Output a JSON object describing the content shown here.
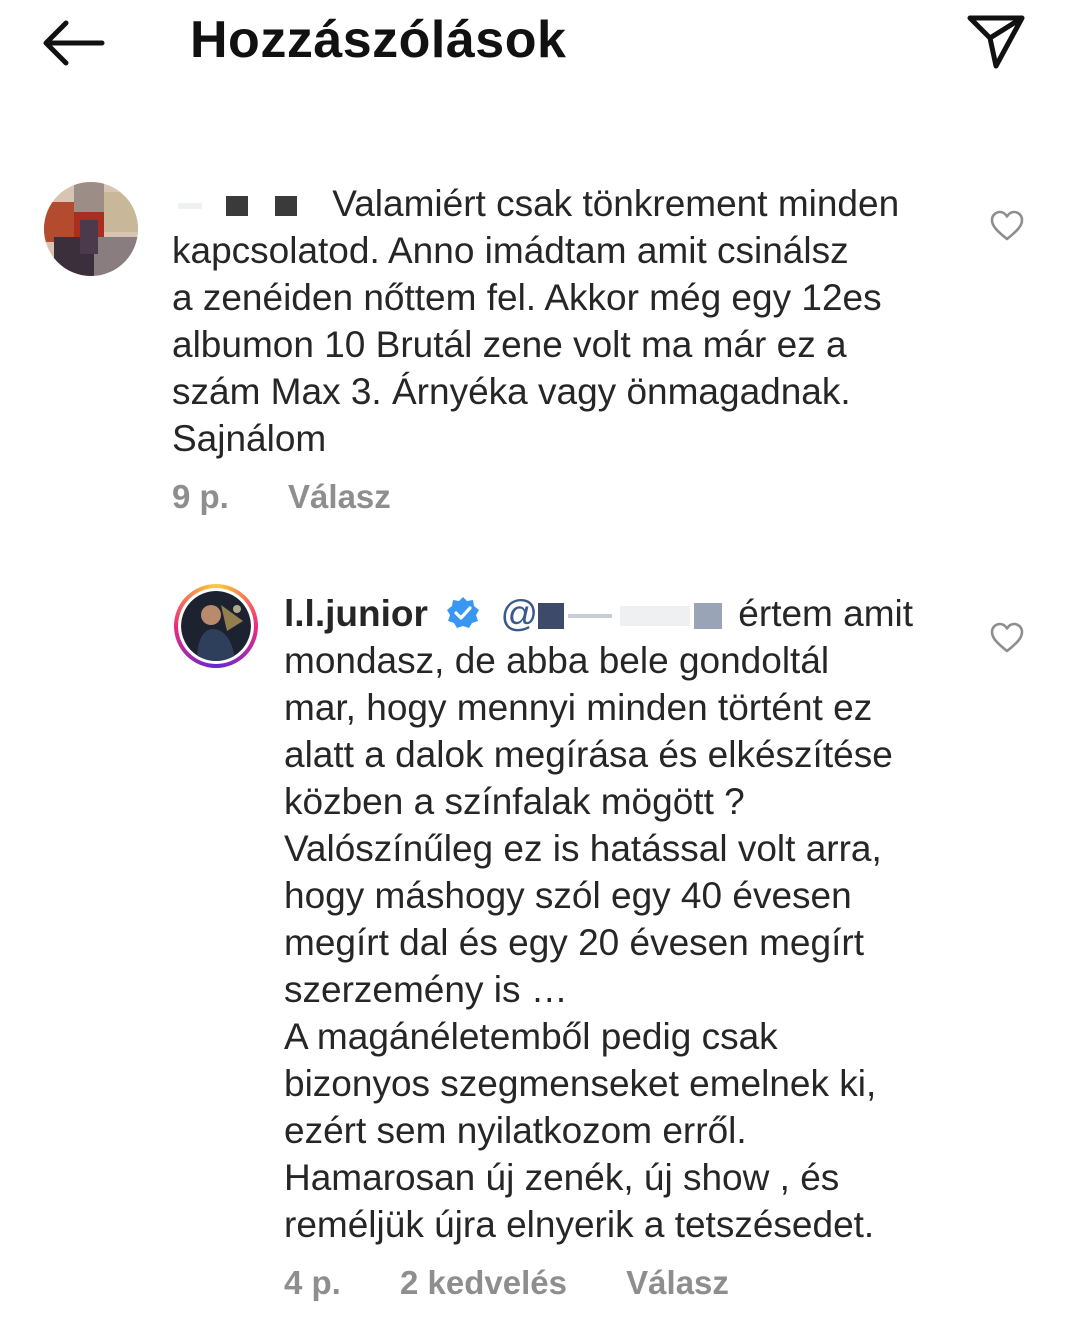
{
  "header": {
    "title": "Hozzászólások",
    "back_icon": "arrow-left-icon",
    "share_icon": "send-paper-plane-icon"
  },
  "comments": [
    {
      "username": "",
      "text_lines": [
        "Valamiért csak tönkrement minden",
        "kapcsolatod.  Anno imádtam amit csinálsz",
        "a zenéiden nőttem fel.  Akkor még egy 12es",
        "albumon 10 Brutál zene volt ma már ez a",
        "szám Max 3.  Árnyéka vagy önmagadnak.",
        "Sajnálom"
      ],
      "time": "9 p.",
      "reply_label": "Válasz"
    },
    {
      "username": "l.l.junior",
      "verified": true,
      "mention_prefix": "@",
      "first_line_rest": "értem amit",
      "text_lines": [
        "mondasz, de abba bele gondoltál",
        "mar, hogy mennyi minden történt ez",
        "alatt a dalok megírása és elkészítése",
        "közben a színfalak mögött ?",
        "Valószínűleg ez is hatással volt arra,",
        "hogy máshogy szól egy 40 évesen",
        "megírt dal és egy 20 évesen megírt",
        "szerzemény is …",
        "A magánéletemből pedig csak",
        "bizonyos szegmenseket emelnek ki,",
        "ezért sem nyilatkozom erről.",
        "Hamarosan új zenék, új show , és",
        "reméljük újra elnyerik a tetszésedet."
      ],
      "time": "4 p.",
      "likes": "2 kedvelés",
      "reply_label": "Válasz"
    }
  ],
  "colors": {
    "text": "#262626",
    "meta": "#8e8e8e",
    "verified": "#3897f0",
    "story_ring": [
      "#f9ce34",
      "#ee2a7b",
      "#6228d7"
    ]
  }
}
